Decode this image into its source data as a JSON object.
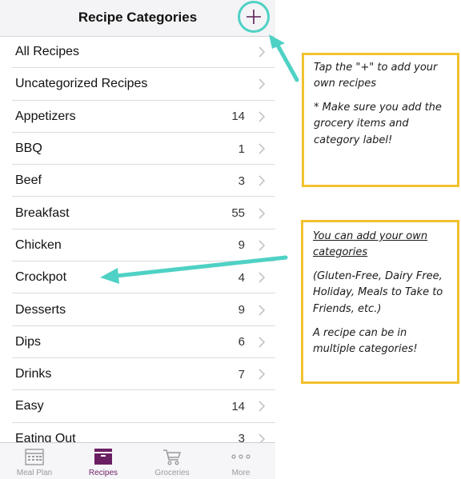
{
  "navbar": {
    "title": "Recipe Categories",
    "add_icon": "plus-icon"
  },
  "categories": [
    {
      "label": "All Recipes",
      "count": ""
    },
    {
      "label": "Uncategorized Recipes",
      "count": ""
    },
    {
      "label": "Appetizers",
      "count": "14"
    },
    {
      "label": "BBQ",
      "count": "1"
    },
    {
      "label": "Beef",
      "count": "3"
    },
    {
      "label": "Breakfast",
      "count": "55"
    },
    {
      "label": "Chicken",
      "count": "9"
    },
    {
      "label": "Crockpot",
      "count": "4"
    },
    {
      "label": "Desserts",
      "count": "9"
    },
    {
      "label": "Dips",
      "count": "6"
    },
    {
      "label": "Drinks",
      "count": "7"
    },
    {
      "label": "Easy",
      "count": "14"
    },
    {
      "label": "Eating Out",
      "count": "3"
    }
  ],
  "tabbar": {
    "tabs": [
      {
        "label": "Meal Plan",
        "icon": "calendar-icon"
      },
      {
        "label": "Recipes",
        "icon": "recipe-box-icon",
        "active": true
      },
      {
        "label": "Groceries",
        "icon": "cart-icon"
      },
      {
        "label": "More",
        "icon": "more-icon"
      }
    ]
  },
  "notes": {
    "note1": {
      "line1": "Tap the \"+\" to add your own recipes",
      "line2": "* Make sure you add the grocery items and category label!"
    },
    "note2": {
      "heading": "You can add your own categories",
      "line1": "(Gluten-Free, Dairy Free, Holiday, Meals to Take to Friends, etc.)",
      "line2": "A recipe can be in multiple categories!"
    }
  },
  "colors": {
    "accent": "#6b1f63",
    "highlight": "#4fd1c5",
    "note_border": "#f2c12e"
  }
}
